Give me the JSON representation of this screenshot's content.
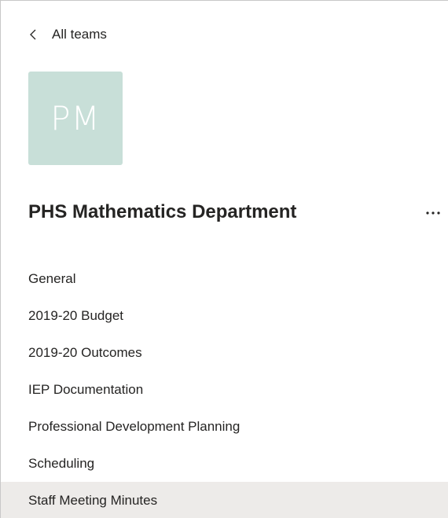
{
  "nav": {
    "back_label": "All teams"
  },
  "team": {
    "avatar_initials": "PM",
    "avatar_color": "#c8dfd8",
    "name": "PHS Mathematics Department",
    "more_options_icon": "ellipsis-icon"
  },
  "channels": [
    {
      "label": "General",
      "selected": false
    },
    {
      "label": "2019-20 Budget",
      "selected": false
    },
    {
      "label": "2019-20 Outcomes",
      "selected": false
    },
    {
      "label": "IEP Documentation",
      "selected": false
    },
    {
      "label": "Professional Development Planning",
      "selected": false
    },
    {
      "label": "Scheduling",
      "selected": false
    },
    {
      "label": "Staff Meeting Minutes",
      "selected": true
    }
  ],
  "colors": {
    "selected_background": "#edebe9",
    "text": "#252423"
  }
}
